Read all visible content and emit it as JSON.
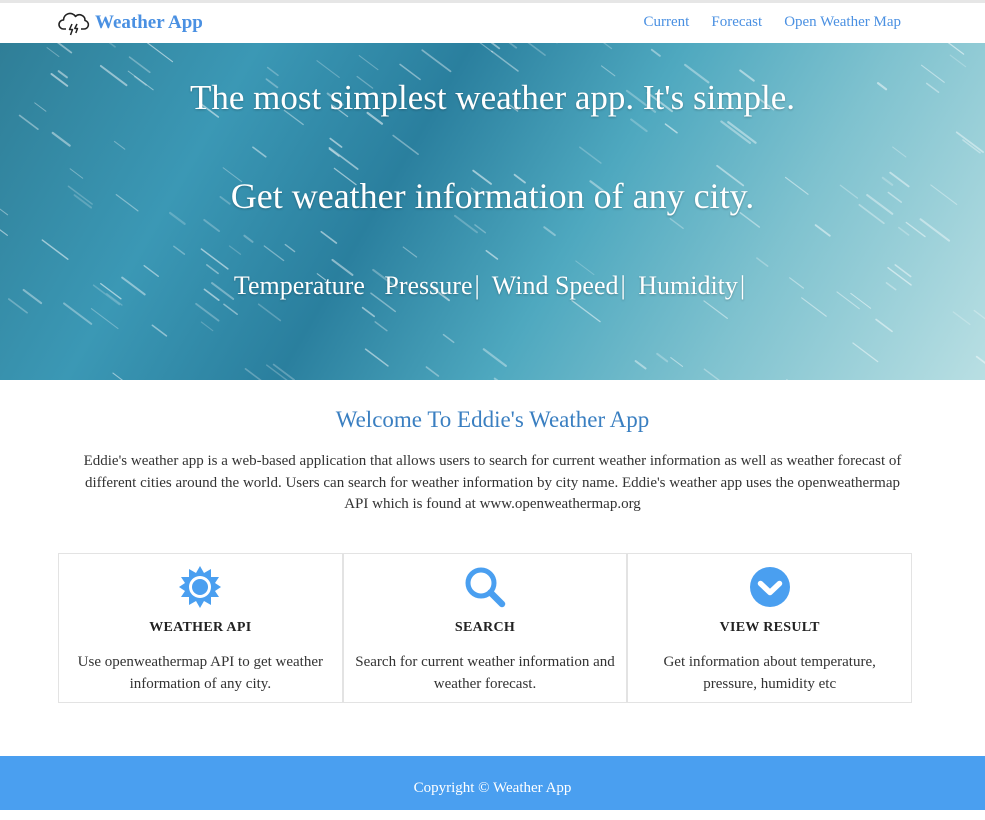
{
  "navbar": {
    "brand": "Weather App",
    "links": [
      "Current",
      "Forecast",
      "Open Weather Map"
    ]
  },
  "hero": {
    "line1": "The most simplest weather app. It's simple.",
    "line2": "Get weather information of any city.",
    "features": [
      "Temperature",
      "Pressure",
      "Wind Speed",
      "Humidity"
    ],
    "separator": "|"
  },
  "welcome": {
    "title": "Welcome To Eddie's Weather App",
    "text": "Eddie's weather app is a web-based application that allows users to search for current weather information as well as weather forecast of different cities around the world. Users can search for weather information by city name. Eddie's weather app uses the openweathermap API which is found at www.openweathermap.org"
  },
  "cards": [
    {
      "icon": "sun-icon",
      "title": "WEATHER API",
      "text": "Use openweathermap API to get weather information of any city."
    },
    {
      "icon": "search-icon",
      "title": "SEARCH",
      "text": "Search for current weather information and weather forecast."
    },
    {
      "icon": "chevron-circle-down-icon",
      "title": "VIEW RESULT",
      "text": "Get information about temperature, pressure, humidity etc"
    }
  ],
  "footer": {
    "text": "Copyright © Weather App"
  },
  "colors": {
    "accent": "#4a90e2",
    "title_blue": "#3a7fc1",
    "footer_bg": "#4a9ff0",
    "icon_blue": "#4a9ff0"
  }
}
